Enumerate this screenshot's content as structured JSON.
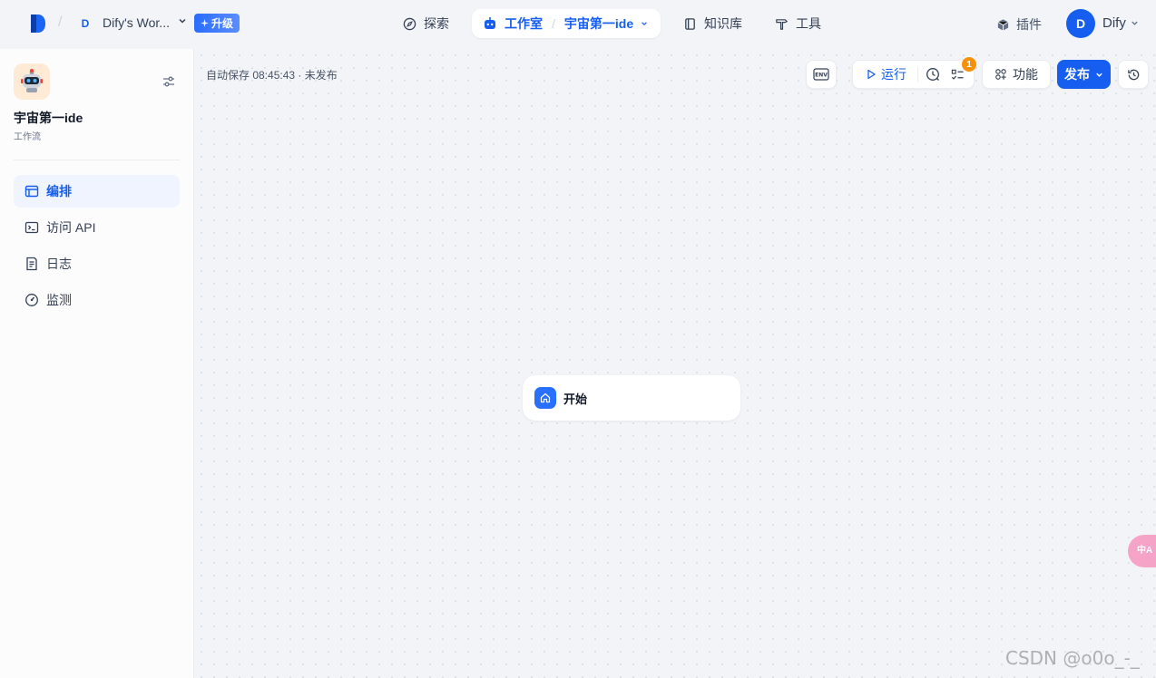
{
  "topbar": {
    "workspace_initial": "D",
    "workspace_name": "Dify's Wor...",
    "upgrade_label": "升级",
    "nav": {
      "explore": "探索",
      "studio": "工作室",
      "current_app": "宇宙第一ide",
      "knowledge": "知识库",
      "tools": "工具"
    },
    "plugins_label": "插件",
    "user_initial": "D",
    "user_name": "Dify"
  },
  "sidebar": {
    "app_name": "宇宙第一ide",
    "app_type": "工作流",
    "items": [
      {
        "label": "编排",
        "icon": "layout-icon",
        "active": true
      },
      {
        "label": "访问 API",
        "icon": "terminal-icon",
        "active": false
      },
      {
        "label": "日志",
        "icon": "file-list-icon",
        "active": false
      },
      {
        "label": "监测",
        "icon": "dashboard-icon",
        "active": false
      }
    ]
  },
  "canvas": {
    "autosave_text": "自动保存 08:45:43 · 未发布",
    "toolbar": {
      "env_label": "ENV",
      "run_label": "运行",
      "checklist_badge": "1",
      "features_label": "功能",
      "publish_label": "发布"
    },
    "start_node_label": "开始"
  },
  "translate_fab": "中A",
  "watermark": "CSDN @o0o_-_",
  "colors": {
    "primary": "#155eef",
    "badge": "#f79009",
    "app_icon_bg": "#ffead5"
  }
}
